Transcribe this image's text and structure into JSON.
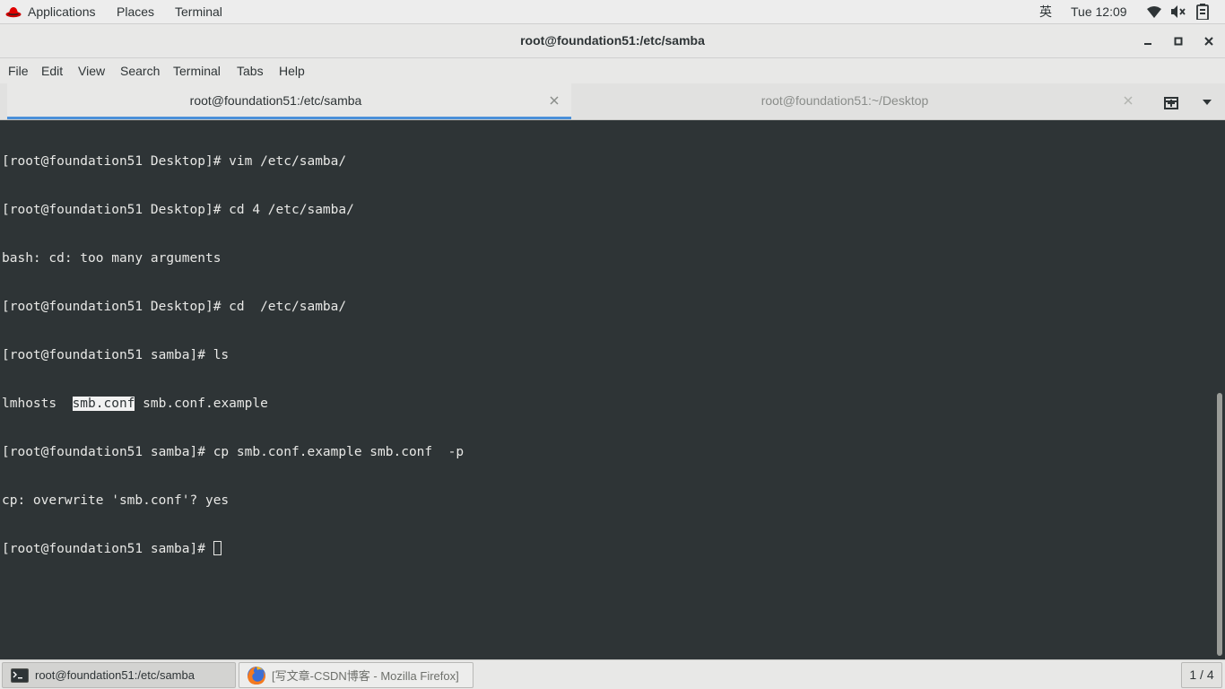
{
  "topbar": {
    "applications_label": "Applications",
    "places_label": "Places",
    "terminal_label": "Terminal",
    "input_method": "英",
    "clock": "Tue 12:09",
    "icons": [
      "wifi-icon",
      "volume-muted-icon",
      "battery-icon"
    ]
  },
  "window": {
    "title": "root@foundation51:/etc/samba"
  },
  "menubar": {
    "items": [
      "File",
      "Edit",
      "View",
      "Search",
      "Terminal",
      "Tabs",
      "Help"
    ]
  },
  "tabs": [
    {
      "label": "root@foundation51:/etc/samba",
      "active": true
    },
    {
      "label": "root@foundation51:~/Desktop",
      "active": false
    }
  ],
  "terminal": {
    "lines": [
      "[root@foundation51 Desktop]# vim /etc/samba/",
      "[root@foundation51 Desktop]# cd 4 /etc/samba/",
      "bash: cd: too many arguments",
      "[root@foundation51 Desktop]# cd  /etc/samba/",
      "[root@foundation51 samba]# ls",
      "[root@foundation51 samba]# cp smb.conf.example smb.conf  -p",
      "cp: overwrite 'smb.conf'? yes",
      "[root@foundation51 samba]# "
    ],
    "ls_output": {
      "before": "lmhosts  ",
      "highlighted": "smb.conf",
      "after": " smb.conf.example"
    }
  },
  "taskbar": {
    "tasks": [
      {
        "label": "root@foundation51:/etc/samba",
        "icon": "terminal-icon",
        "active": true
      },
      {
        "label": "[写文章-CSDN博客 - Mozilla Firefox]",
        "icon": "firefox-icon",
        "active": false
      }
    ],
    "workspace": "1 / 4"
  },
  "colors": {
    "terminal_bg": "#2e3436",
    "terminal_fg": "#e8e8e6",
    "accent": "#4a90d9",
    "chrome_bg": "#e8e8e7"
  }
}
